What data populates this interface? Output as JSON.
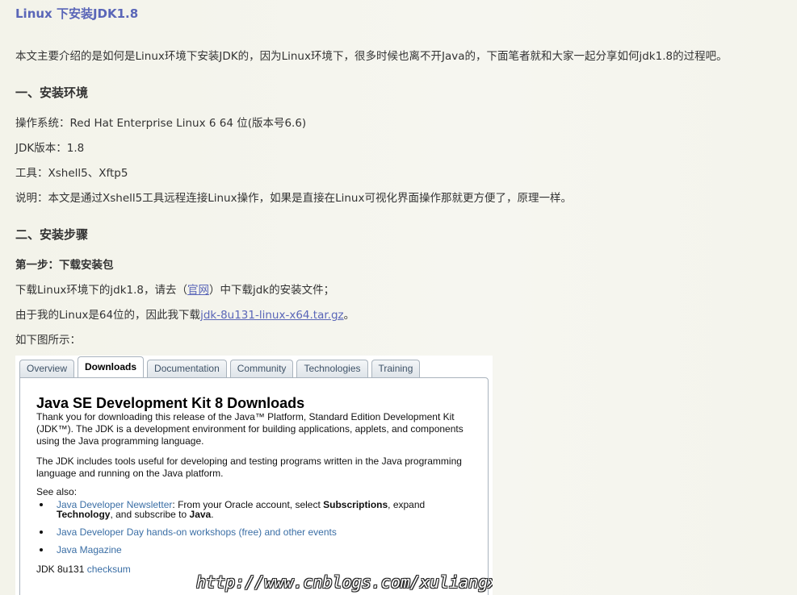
{
  "article": {
    "title": "Linux 下安装JDK1.8",
    "intro": "本文主要介绍的是如何是Linux环境下安装JDK的，因为Linux环境下，很多时候也离不开Java的，下面笔者就和大家一起分享如何jdk1.8的过程吧。",
    "section1": {
      "heading": "一、安装环境",
      "os": "操作系统：Red Hat Enterprise Linux 6 64 位(版本号6.6)",
      "jdk": "JDK版本：1.8",
      "tools": "工具：Xshell5、Xftp5",
      "note": "说明：本文是通过Xshell5工具远程连接Linux操作，如果是直接在Linux可视化界面操作那就更方便了，原理一样。"
    },
    "section2": {
      "heading": "二、安装步骤",
      "step1_heading": "第一步：下载安装包",
      "step1_line1_pre": "下载Linux环境下的jdk1.8，请去（",
      "step1_line1_link": "官网",
      "step1_line1_post": "）中下载jdk的安装文件；",
      "step1_line2_pre": "由于我的Linux是64位的，因此我下载",
      "step1_line2_link": "jdk-8u131-linux-x64.tar.gz",
      "step1_line2_post": "。",
      "step1_line3": "如下图所示："
    }
  },
  "screenshot": {
    "tabs": [
      {
        "label": "Overview"
      },
      {
        "label": "Downloads"
      },
      {
        "label": "Documentation"
      },
      {
        "label": "Community"
      },
      {
        "label": "Technologies"
      },
      {
        "label": "Training"
      }
    ],
    "active_tab": "Downloads",
    "heading": "Java SE Development Kit 8 Downloads",
    "para1": "Thank you for downloading this release of the Java™ Platform, Standard Edition Development Kit (JDK™). The JDK is a development environment for building applications, applets, and components using the Java programming language.",
    "para2": "The JDK includes tools useful for developing and testing programs written in the Java programming language and running on the Java platform.",
    "see_also": "See also:",
    "see_also_items": {
      "newsletter_link": "Java Developer Newsletter",
      "newsletter_t1": ": From your Oracle account, select ",
      "newsletter_b1": "Subscriptions",
      "newsletter_t2": ", expand",
      "newsletter_b2": "Technology",
      "newsletter_t3": ", and subscribe to ",
      "newsletter_b3": "Java",
      "newsletter_t4": ".",
      "devday": "Java Developer Day hands-on workshops (free) and other events",
      "magazine": "Java Magazine"
    },
    "version_label": "JDK 8u131 ",
    "checksum": "checksum",
    "watermark": "http://www.cnblogs.com/xuliangxing"
  },
  "colors": {
    "title": "#5a66b8",
    "link": "#5a66b8",
    "oracle_link": "#3a6ea5",
    "background": "#f5f5ee"
  }
}
